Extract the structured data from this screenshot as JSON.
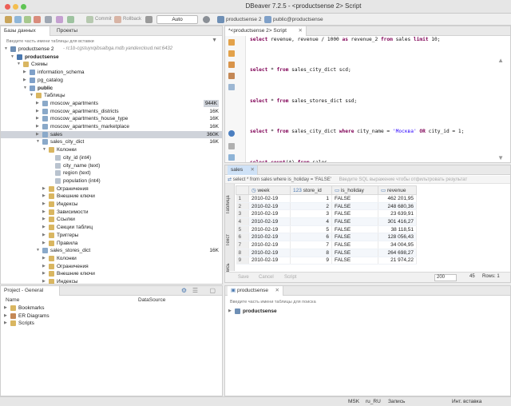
{
  "window": {
    "title": "DBeaver 7.2.5 - <productsense 2> Script"
  },
  "toolbar": {
    "commit_label": "Commit",
    "rollback_label": "Rollback",
    "transaction_mode": "Auto",
    "connection": "productsense 2",
    "schema": "public@productsense"
  },
  "navigator": {
    "tabs": [
      "Базы данных",
      "Проекты"
    ],
    "filter_placeholder": "Введите часть имени таблицы для вставки",
    "items": [
      {
        "label": "productsense 2",
        "meta": "- rc1b-cgstuyxqibsalbga.mdb.yandexcloud.net:6432",
        "size": "",
        "indent": 0,
        "icon": "database-connection-icon",
        "open": true,
        "bold": false
      },
      {
        "label": "productsense",
        "meta": "",
        "size": "",
        "indent": 1,
        "icon": "database-icon",
        "open": true,
        "bold": true
      },
      {
        "label": "Схемы",
        "meta": "",
        "size": "",
        "indent": 2,
        "icon": "folder-icon",
        "open": true,
        "bold": false
      },
      {
        "label": "information_schema",
        "meta": "",
        "size": "",
        "indent": 3,
        "icon": "schema-icon",
        "open": false,
        "bold": false
      },
      {
        "label": "pg_catalog",
        "meta": "",
        "size": "",
        "indent": 3,
        "icon": "schema-icon",
        "open": false,
        "bold": false
      },
      {
        "label": "public",
        "meta": "",
        "size": "",
        "indent": 3,
        "icon": "schema-icon",
        "open": true,
        "bold": true
      },
      {
        "label": "Таблицы",
        "meta": "",
        "size": "",
        "indent": 4,
        "icon": "folder-icon",
        "open": true,
        "bold": false
      },
      {
        "label": "moscow_apartments",
        "meta": "",
        "size": "944K",
        "indent": 5,
        "icon": "table-icon",
        "open": false,
        "bold": false,
        "selected_size": true
      },
      {
        "label": "moscow_apartments_districts",
        "meta": "",
        "size": "16K",
        "indent": 5,
        "icon": "table-icon",
        "open": false,
        "bold": false
      },
      {
        "label": "moscow_apartments_house_type",
        "meta": "",
        "size": "16K",
        "indent": 5,
        "icon": "table-icon",
        "open": false,
        "bold": false
      },
      {
        "label": "moscow_apartments_marketplace",
        "meta": "",
        "size": "16K",
        "indent": 5,
        "icon": "table-icon",
        "open": false,
        "bold": false
      },
      {
        "label": "sales",
        "meta": "",
        "size": "360K",
        "indent": 5,
        "icon": "table-icon",
        "open": false,
        "bold": false,
        "selected": true
      },
      {
        "label": "sales_city_dict",
        "meta": "",
        "size": "16K",
        "indent": 5,
        "icon": "table-icon",
        "open": true,
        "bold": false
      },
      {
        "label": "Колонки",
        "meta": "",
        "size": "",
        "indent": 6,
        "icon": "folder-icon",
        "open": true,
        "bold": false
      },
      {
        "label": "city_id (int4)",
        "meta": "",
        "size": "",
        "indent": 7,
        "icon": "column-icon",
        "open": null,
        "bold": false
      },
      {
        "label": "city_name (text)",
        "meta": "",
        "size": "",
        "indent": 7,
        "icon": "column-icon",
        "open": null,
        "bold": false
      },
      {
        "label": "region (text)",
        "meta": "",
        "size": "",
        "indent": 7,
        "icon": "column-icon",
        "open": null,
        "bold": false
      },
      {
        "label": "population (int4)",
        "meta": "",
        "size": "",
        "indent": 7,
        "icon": "column-icon",
        "open": null,
        "bold": false
      },
      {
        "label": "Ограничения",
        "meta": "",
        "size": "",
        "indent": 6,
        "icon": "folder-icon",
        "open": false,
        "bold": false
      },
      {
        "label": "Внешние ключи",
        "meta": "",
        "size": "",
        "indent": 6,
        "icon": "folder-icon",
        "open": false,
        "bold": false
      },
      {
        "label": "Индексы",
        "meta": "",
        "size": "",
        "indent": 6,
        "icon": "folder-icon",
        "open": false,
        "bold": false
      },
      {
        "label": "Зависимости",
        "meta": "",
        "size": "",
        "indent": 6,
        "icon": "folder-icon",
        "open": false,
        "bold": false
      },
      {
        "label": "Ссылки",
        "meta": "",
        "size": "",
        "indent": 6,
        "icon": "folder-icon",
        "open": false,
        "bold": false
      },
      {
        "label": "Секции таблиц",
        "meta": "",
        "size": "",
        "indent": 6,
        "icon": "folder-icon",
        "open": false,
        "bold": false
      },
      {
        "label": "Триггеры",
        "meta": "",
        "size": "",
        "indent": 6,
        "icon": "folder-icon",
        "open": false,
        "bold": false
      },
      {
        "label": "Правила",
        "meta": "",
        "size": "",
        "indent": 6,
        "icon": "folder-icon",
        "open": false,
        "bold": false
      },
      {
        "label": "sales_stores_dict",
        "meta": "",
        "size": "16K",
        "indent": 5,
        "icon": "table-icon",
        "open": true,
        "bold": false
      },
      {
        "label": "Колонки",
        "meta": "",
        "size": "",
        "indent": 6,
        "icon": "folder-icon",
        "open": false,
        "bold": false
      },
      {
        "label": "Ограничения",
        "meta": "",
        "size": "",
        "indent": 6,
        "icon": "folder-icon",
        "open": false,
        "bold": false
      },
      {
        "label": "Внешние ключи",
        "meta": "",
        "size": "",
        "indent": 6,
        "icon": "folder-icon",
        "open": false,
        "bold": false
      },
      {
        "label": "Индексы",
        "meta": "",
        "size": "",
        "indent": 6,
        "icon": "folder-icon",
        "open": false,
        "bold": false
      },
      {
        "label": "Зависимости",
        "meta": "",
        "size": "",
        "indent": 6,
        "icon": "folder-icon",
        "open": false,
        "bold": false
      }
    ]
  },
  "project": {
    "tab": "Project - General",
    "col_name": "Name",
    "col_datasource": "DataSource",
    "items": [
      "Bookmarks",
      "ER Diagrams",
      "Scripts"
    ]
  },
  "editor": {
    "tab": "*<productsense 2> Script",
    "lines": [
      {
        "text": "select revenue, revenue / 1000 as revenue_2 from sales limit 10;",
        "hl": false
      },
      {
        "text": "",
        "hl": false
      },
      {
        "text": "",
        "hl": false
      },
      {
        "text": "select * from sales_city_dict scd;",
        "hl": false
      },
      {
        "text": "",
        "hl": false
      },
      {
        "text": "",
        "hl": false
      },
      {
        "text": "select * from sales_stores_dict ssd;",
        "hl": false
      },
      {
        "text": "",
        "hl": false
      },
      {
        "text": "",
        "hl": false
      },
      {
        "text": "select * from sales_city_dict where city_name = 'Москва' OR city_id = 1;",
        "hl": false
      },
      {
        "text": "",
        "hl": false
      },
      {
        "text": "",
        "hl": false
      },
      {
        "text": "select count(*) from sales",
        "hl": false
      },
      {
        "text": "where is_holiday = 'FALSE' and",
        "hl": true
      },
      {
        "text": "week = '2010-02-19';",
        "hl": true
      }
    ]
  },
  "results": {
    "tab": "sales",
    "query": "select * from sales where is_holiday = 'FALSE'",
    "filter_placeholder": "Введите SQL выражение чтобы отфильтровать результат",
    "side_tabs": [
      "Таблица",
      "Текст",
      "Запись"
    ],
    "columns": [
      "week",
      "store_id",
      "is_holiday",
      "revenue"
    ],
    "rows": [
      [
        "1",
        "2010-02-19",
        "1",
        "FALSE",
        "462 201,95"
      ],
      [
        "2",
        "2010-02-19",
        "2",
        "FALSE",
        "248 680,36"
      ],
      [
        "3",
        "2010-02-19",
        "3",
        "FALSE",
        "23 639,91"
      ],
      [
        "4",
        "2010-02-19",
        "4",
        "FALSE",
        "301 416,27"
      ],
      [
        "5",
        "2010-02-19",
        "5",
        "FALSE",
        "38 118,51"
      ],
      [
        "6",
        "2010-02-19",
        "6",
        "FALSE",
        "128 056,43"
      ],
      [
        "7",
        "2010-02-19",
        "7",
        "FALSE",
        "34 004,95"
      ],
      [
        "8",
        "2010-02-19",
        "8",
        "FALSE",
        "264 698,27"
      ],
      [
        "9",
        "2010-02-19",
        "9",
        "FALSE",
        "21 974,22"
      ]
    ],
    "footer": {
      "save": "Save",
      "cancel": "Cancel",
      "script": "Script",
      "fetch_size": "200",
      "row_count": "45",
      "rows_label": "Rows: 1"
    }
  },
  "db_panel": {
    "tab": "productsense",
    "filter_placeholder": "Введите часть имени таблицы для поиска",
    "item": "productsense"
  },
  "statusbar": {
    "tz": "MSK",
    "locale": "ru_RU",
    "mode": "Запись",
    "insert": "Инт. вставка"
  }
}
